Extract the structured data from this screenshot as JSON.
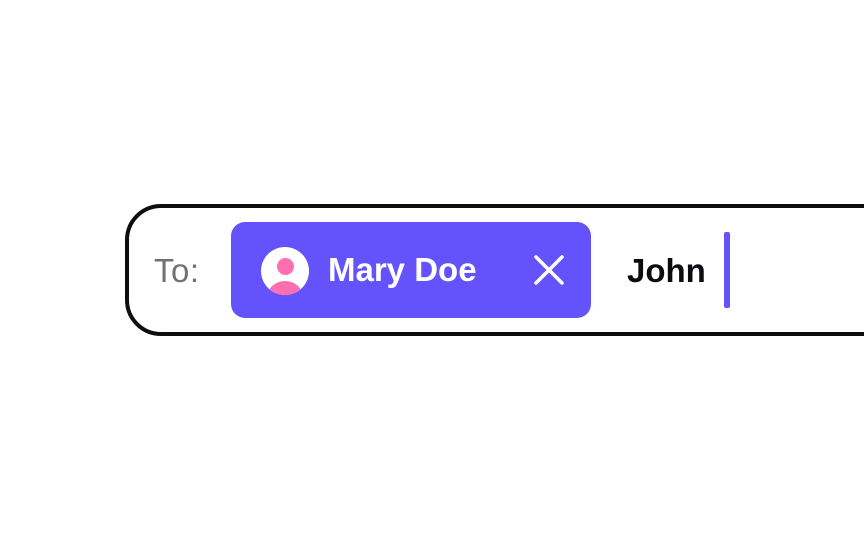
{
  "recipient_field": {
    "label": "To:",
    "chips": [
      {
        "name": "Mary Doe",
        "avatar_icon": "person-icon",
        "remove_icon": "close-icon"
      }
    ],
    "typed_value": "John"
  },
  "colors": {
    "chip_background": "#6453fd",
    "avatar_accent": "#ff6fb0",
    "caret": "#6453fd",
    "border": "#0d0d12",
    "label": "#707078"
  }
}
